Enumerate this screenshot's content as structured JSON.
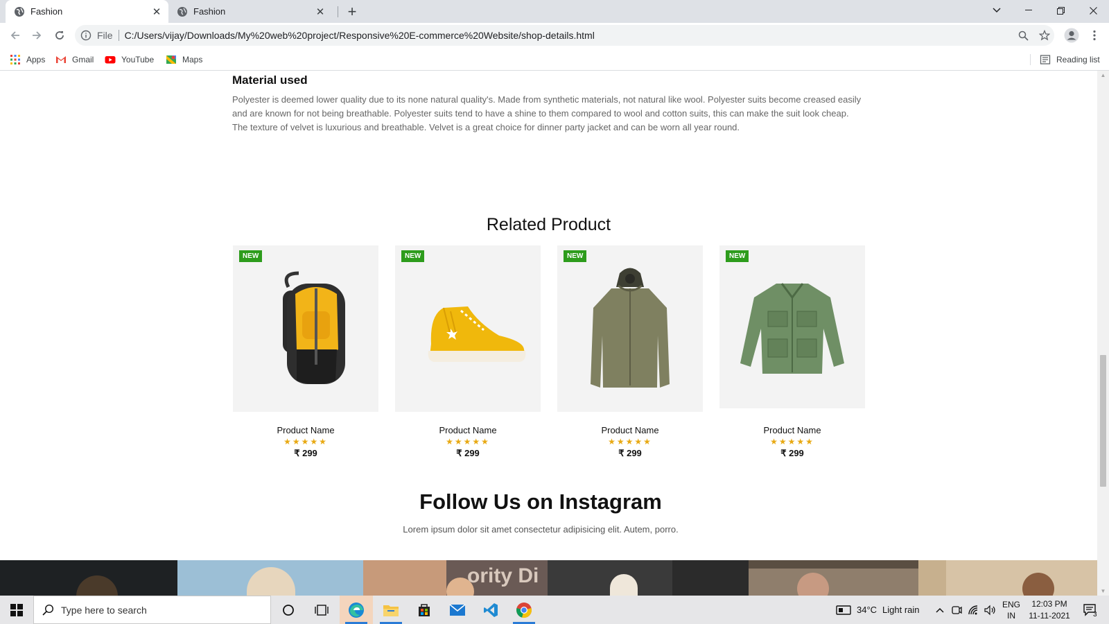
{
  "browser": {
    "tabs": [
      {
        "title": "Fashion",
        "active": true
      },
      {
        "title": "Fashion",
        "active": false
      }
    ],
    "address": {
      "scheme_label": "File",
      "url": "C:/Users/vijay/Downloads/My%20web%20project/Responsive%20E-commerce%20Website/shop-details.html"
    },
    "bookmarks": [
      {
        "label": "Apps",
        "icon": "apps-grid-icon"
      },
      {
        "label": "Gmail",
        "icon": "gmail-icon"
      },
      {
        "label": "YouTube",
        "icon": "youtube-icon"
      },
      {
        "label": "Maps",
        "icon": "maps-icon"
      }
    ],
    "reading_list": "Reading list"
  },
  "page": {
    "material": {
      "title": "Material used",
      "text": "Polyester is deemed lower quality due to its none natural quality's. Made from synthetic materials, not natural like wool. Polyester suits become creased easily and are known for not being breathable. Polyester suits tend to have a shine to them compared to wool and cotton suits, this can make the suit look cheap. The texture of velvet is luxurious and breathable. Velvet is a great choice for dinner party jacket and can be worn all year round."
    },
    "related": {
      "title": "Related Product",
      "products": [
        {
          "badge": "NEW",
          "name": "Product Name",
          "rating": 5,
          "stars": "★★★★★",
          "price": "₹ 299",
          "image": "yellow-backpack"
        },
        {
          "badge": "NEW",
          "name": "Product Name",
          "rating": 5,
          "stars": "★★★★★",
          "price": "₹ 299",
          "image": "yellow-sneaker"
        },
        {
          "badge": "NEW",
          "name": "Product Name",
          "rating": 5,
          "stars": "★★★★★",
          "price": "₹ 299",
          "image": "olive-hooded-jacket"
        },
        {
          "badge": "NEW",
          "name": "Product Name",
          "rating": 5,
          "stars": "★★★★★",
          "price": "₹ 299",
          "image": "green-shirt-jacket"
        }
      ]
    },
    "instagram": {
      "title": "Follow Us on Instagram",
      "subtitle": "Lorem ipsum dolor sit amet consectetur adipisicing elit. Autem, porro.",
      "signage_text": "ority Di"
    }
  },
  "taskbar": {
    "search_placeholder": "Type here to search",
    "weather": {
      "temp": "34°C",
      "condition": "Light rain"
    },
    "language": {
      "lang": "ENG",
      "region": "IN"
    },
    "clock": {
      "time": "12:03 PM",
      "date": "11-11-2021"
    },
    "notification_count": "3"
  },
  "colors": {
    "badge_green": "#2d9c1c",
    "star_gold": "#e8a913",
    "chrome_tabstrip": "#dee1e6"
  }
}
